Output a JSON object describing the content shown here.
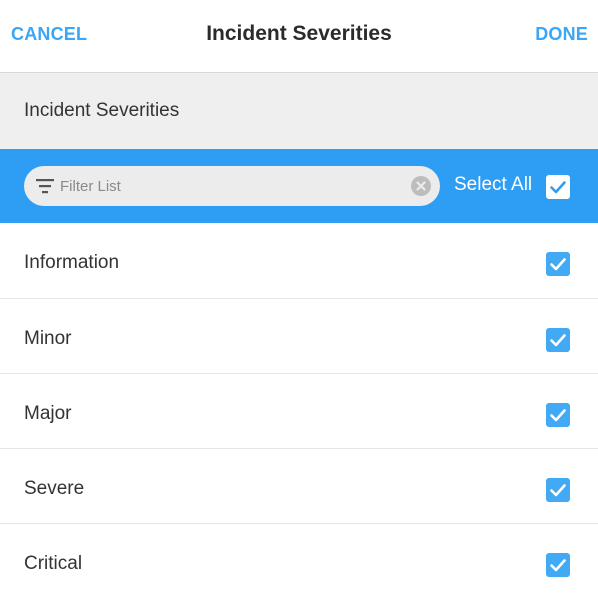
{
  "colors": {
    "accent": "#2e9ef5",
    "link": "#3ba6f5",
    "checkbox": "#42a9f5",
    "header_bg": "#efefef"
  },
  "nav": {
    "cancel_label": "CANCEL",
    "title": "Incident Severities",
    "done_label": "DONE"
  },
  "section": {
    "label": "Incident Severities"
  },
  "filter": {
    "placeholder": "Filter List",
    "value": "",
    "filter_icon": "filter-icon",
    "clear_icon": "clear-icon",
    "select_all_label": "Select All",
    "select_all_checked": true
  },
  "items": [
    {
      "label": "Information",
      "checked": true
    },
    {
      "label": "Minor",
      "checked": true
    },
    {
      "label": "Major",
      "checked": true
    },
    {
      "label": "Severe",
      "checked": true
    },
    {
      "label": "Critical",
      "checked": true
    }
  ]
}
